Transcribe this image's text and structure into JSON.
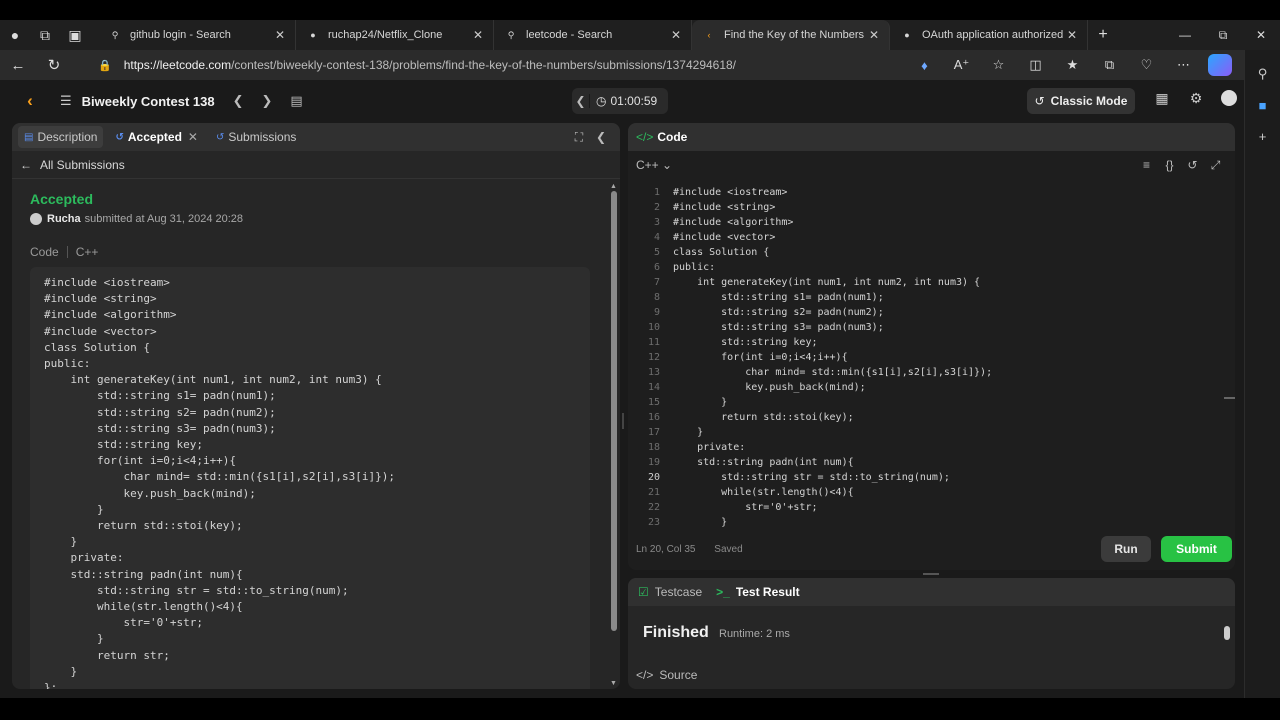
{
  "browser": {
    "tabs": [
      {
        "title": "github login - Search",
        "favicon": "search-icon"
      },
      {
        "title": "ruchap24/Netflix_Clone",
        "favicon": "github-icon"
      },
      {
        "title": "leetcode - Search",
        "favicon": "search-icon"
      },
      {
        "title": "Find the Key of the Numbers - Le",
        "favicon": "leetcode-icon"
      },
      {
        "title": "OAuth application authorized",
        "favicon": "github-icon"
      }
    ],
    "url_domain": "https://leetcode.com",
    "url_path": "/contest/biweekly-contest-138/problems/find-the-key-of-the-numbers/submissions/1374294618/"
  },
  "header": {
    "contest_title": "Biweekly Contest 138",
    "timer": "01:00:59",
    "classic_mode_label": "Classic Mode"
  },
  "left_panel": {
    "tabs": {
      "description": "Description",
      "accepted": "Accepted",
      "submissions": "Submissions"
    },
    "all_submissions": "All Submissions",
    "status": "Accepted",
    "author": "Rucha",
    "submitted_text": "submitted at Aug 31, 2024 20:28",
    "code_label": "Code",
    "lang": "C++",
    "code": [
      "#include <iostream>",
      "#include <string>",
      "#include <algorithm>",
      "#include <vector>",
      "class Solution {",
      "public:",
      "    int generateKey(int num1, int num2, int num3) {",
      "        std::string s1= padn(num1);",
      "        std::string s2= padn(num2);",
      "        std::string s3= padn(num3);",
      "        std::string key;",
      "        for(int i=0;i<4;i++){",
      "            char mind= std::min({s1[i],s2[i],s3[i]});",
      "            key.push_back(mind);",
      "        }",
      "        return std::stoi(key);",
      "    }",
      "    private:",
      "    std::string padn(int num){",
      "        std::string str = std::to_string(num);",
      "        while(str.length()<4){",
      "            str='0'+str;",
      "        }",
      "        return str;",
      "    }",
      "};"
    ]
  },
  "code_panel": {
    "title": "Code",
    "lang": "C++",
    "lines": [
      {
        "n": "1",
        "t": "#include <iostream>"
      },
      {
        "n": "2",
        "t": "#include <string>"
      },
      {
        "n": "3",
        "t": "#include <algorithm>"
      },
      {
        "n": "4",
        "t": "#include <vector>"
      },
      {
        "n": "5",
        "t": "class Solution {"
      },
      {
        "n": "6",
        "t": "public:"
      },
      {
        "n": "7",
        "t": "    int generateKey(int num1, int num2, int num3) {"
      },
      {
        "n": "8",
        "t": "        std::string s1= padn(num1);"
      },
      {
        "n": "9",
        "t": "        std::string s2= padn(num2);"
      },
      {
        "n": "10",
        "t": "        std::string s3= padn(num3);"
      },
      {
        "n": "11",
        "t": "        std::string key;"
      },
      {
        "n": "12",
        "t": "        for(int i=0;i<4;i++){"
      },
      {
        "n": "13",
        "t": "            char mind= std::min({s1[i],s2[i],s3[i]});"
      },
      {
        "n": "14",
        "t": "            key.push_back(mind);"
      },
      {
        "n": "15",
        "t": "        }"
      },
      {
        "n": "16",
        "t": "        return std::stoi(key);"
      },
      {
        "n": "17",
        "t": "    }"
      },
      {
        "n": "18",
        "t": "    private:"
      },
      {
        "n": "19",
        "t": "    std::string padn(int num){"
      },
      {
        "n": "20",
        "t": "        std::string str = std::to_string(num);"
      },
      {
        "n": "21",
        "t": "        while(str.length()<4){"
      },
      {
        "n": "22",
        "t": "            str='0'+str;"
      },
      {
        "n": "23",
        "t": "        }"
      }
    ],
    "cursor_position": "Ln 20, Col 35",
    "save_state": "Saved",
    "run_label": "Run",
    "submit_label": "Submit"
  },
  "result_panel": {
    "testcase_tab": "Testcase",
    "test_result_tab": "Test Result",
    "status": "Finished",
    "runtime": "Runtime: 2 ms",
    "source": "Source"
  },
  "colors": {
    "accepted": "#2cbb5d",
    "submit": "#28c244",
    "brand": "#f89f1b"
  }
}
